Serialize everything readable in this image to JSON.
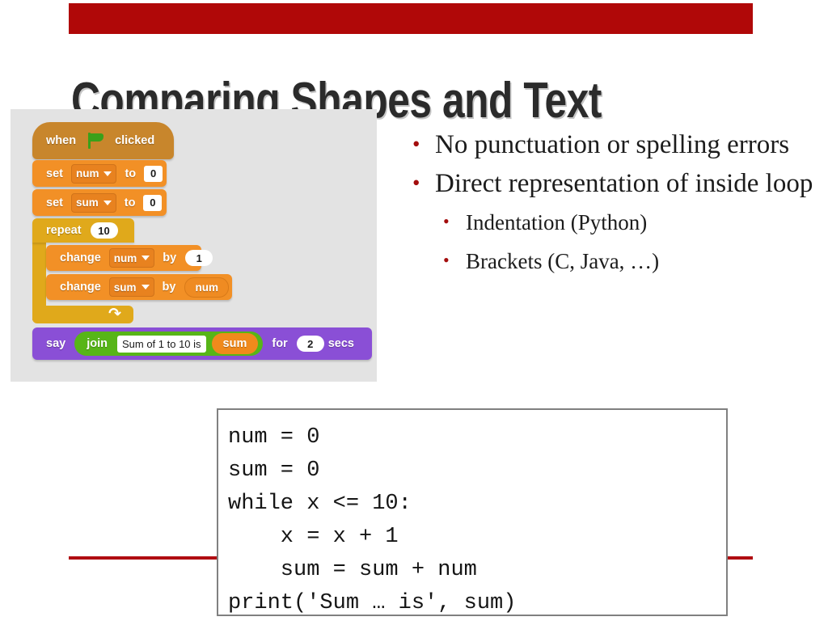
{
  "slide": {
    "title": "Comparing Shapes and Text",
    "corner_mark": "",
    "accent_color": "#b00808",
    "rule_color": "#b00d12",
    "title_color": "#2b2b2b"
  },
  "scratch": {
    "background_color": "#e3e3e3",
    "hat": {
      "when_label": "when",
      "flag_icon": "green-flag-icon",
      "clicked_label": "clicked"
    },
    "set_num": {
      "keyword": "set",
      "variable": "num",
      "to_label": "to",
      "value": "0"
    },
    "set_sum": {
      "keyword": "set",
      "variable": "sum",
      "to_label": "to",
      "value": "0"
    },
    "repeat": {
      "keyword": "repeat",
      "count": "10",
      "loop_arrow_icon": "loop-arrow-icon"
    },
    "change_num": {
      "keyword": "change",
      "variable": "num",
      "by_label": "by",
      "value": "1"
    },
    "change_sum": {
      "keyword": "change",
      "variable": "sum",
      "by_label": "by",
      "value": "num"
    },
    "say": {
      "keyword": "say",
      "join_label": "join",
      "join_text": "Sum of 1 to 10 is",
      "join_variable": "sum",
      "for_label": "for",
      "seconds": "2",
      "secs_label": "secs"
    }
  },
  "bullets": {
    "level1": [
      "No punctuation or spelling errors",
      "Direct representation of inside loop"
    ],
    "level2": [
      "Indentation (Python)",
      "Brackets (C, Java, …)"
    ]
  },
  "code": {
    "text": "num = 0\nsum = 0\nwhile x <= 10:\n    x = x + 1\n    sum = sum + num\nprint('Sum … is', sum)"
  }
}
